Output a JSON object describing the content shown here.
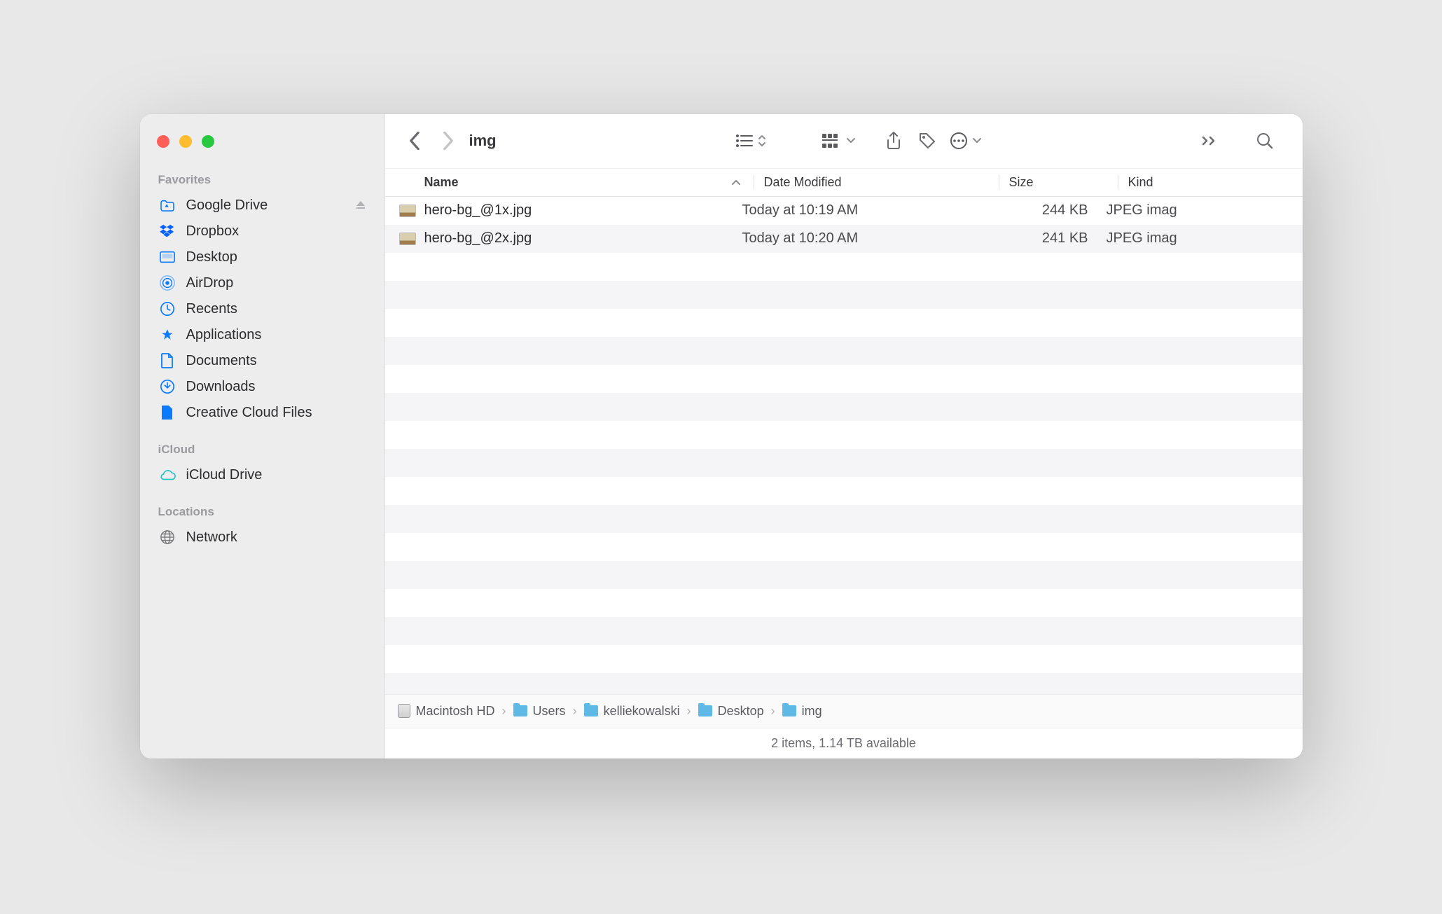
{
  "sidebar": {
    "sections": {
      "favorites": {
        "label": "Favorites",
        "items": [
          {
            "label": "Google Drive",
            "eject": true
          },
          {
            "label": "Dropbox"
          },
          {
            "label": "Desktop"
          },
          {
            "label": "AirDrop"
          },
          {
            "label": "Recents"
          },
          {
            "label": "Applications"
          },
          {
            "label": "Documents"
          },
          {
            "label": "Downloads"
          },
          {
            "label": "Creative Cloud Files"
          }
        ]
      },
      "icloud": {
        "label": "iCloud",
        "items": [
          {
            "label": "iCloud Drive"
          }
        ]
      },
      "locations": {
        "label": "Locations",
        "items": [
          {
            "label": "Network"
          }
        ]
      }
    }
  },
  "toolbar": {
    "title": "img"
  },
  "columns": {
    "name": "Name",
    "date": "Date Modified",
    "size": "Size",
    "kind": "Kind"
  },
  "files": [
    {
      "name": "hero-bg_@1x.jpg",
      "date": "Today at 10:19 AM",
      "size": "244 KB",
      "kind": "JPEG imag"
    },
    {
      "name": "hero-bg_@2x.jpg",
      "date": "Today at 10:20 AM",
      "size": "241 KB",
      "kind": "JPEG imag"
    }
  ],
  "path": [
    "Macintosh HD",
    "Users",
    "kelliekowalski",
    "Desktop",
    "img"
  ],
  "status": "2 items, 1.14 TB available"
}
